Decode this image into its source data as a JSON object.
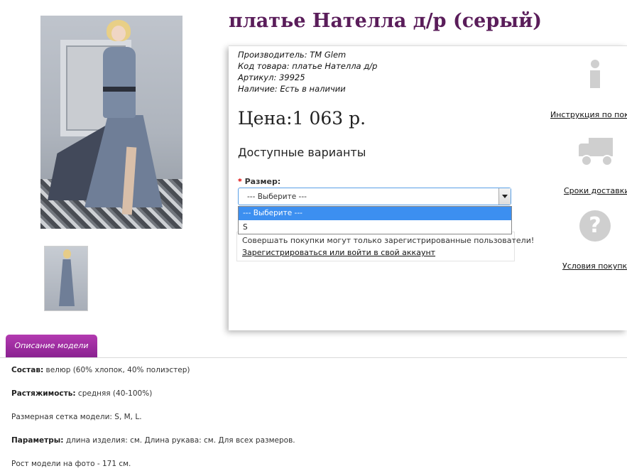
{
  "product": {
    "title": "платье Нателла д/р (серый)",
    "manufacturer_label": "Производитель:",
    "manufacturer_value": "TM Glem",
    "code_label": "Код товара:",
    "code_value": "платье Нателла д/р",
    "sku_label": "Артикул:",
    "sku_value": "39925",
    "stock_label": "Наличие:",
    "stock_value": "Есть в наличии",
    "price": "Цена:1 063 р.",
    "variants_heading": "Доступные варианты",
    "size_required_mark": "*",
    "size_label": "Размер:",
    "size_select_value": "--- Выберите ---",
    "size_options": [
      "--- Выберите ---",
      "S"
    ],
    "notice_text": "Совершать покупки могут только зарегистрированные пользователи!",
    "notice_link": "Зарегистрироваться или войти в свой аккаунт"
  },
  "side_links": {
    "instruction": "Инструкция по поку",
    "delivery": "Сроки доставки",
    "terms": "Условия покупки"
  },
  "icons": {
    "info": "info-icon",
    "delivery": "truck-icon",
    "terms": "question-icon"
  },
  "tabs": {
    "description": "Описание модели"
  },
  "description": {
    "composition_label": "Состав:",
    "composition_value": " велюр (60% хлопок, 40% полиэстер)",
    "stretch_label": "Растяжимость:",
    "stretch_value": " средняя (40-100%)",
    "grid_text": "Размерная сетка модели: S, M, L.",
    "params_label": "Параметры:",
    "params_value": " длина изделия: см. Длина рукава: см. Для всех размеров.",
    "model_height": "Рост модели на фото - 171 см."
  },
  "colors": {
    "title": "#5a1d5a",
    "tab": "#a12fa6",
    "dropdown_selected": "#3c8ff0"
  }
}
